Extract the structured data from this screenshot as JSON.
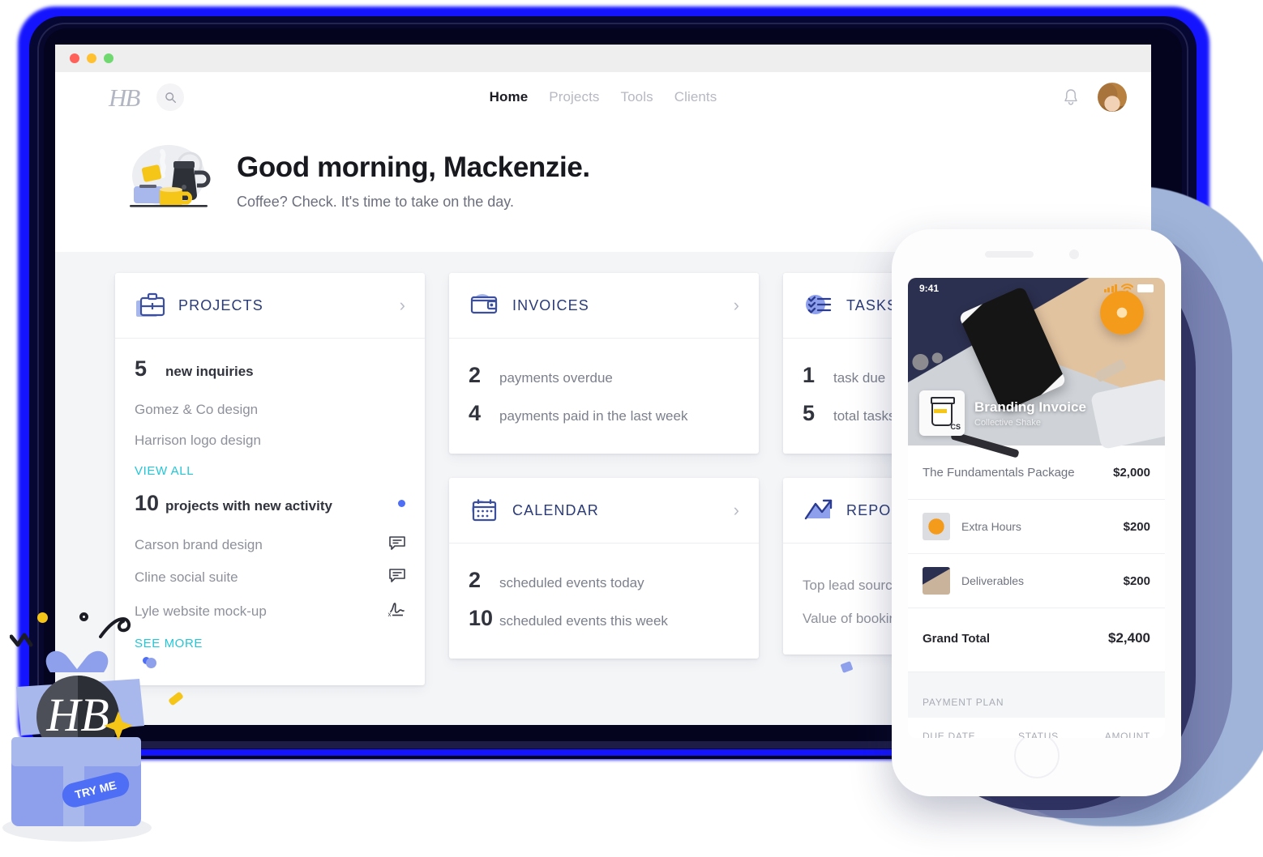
{
  "browser": {
    "traffic_lights": [
      "close",
      "minimize",
      "maximize"
    ]
  },
  "nav": {
    "logo": "HB",
    "search_icon": "search-icon",
    "links": [
      {
        "label": "Home",
        "active": true
      },
      {
        "label": "Projects",
        "active": false
      },
      {
        "label": "Tools",
        "active": false
      },
      {
        "label": "Clients",
        "active": false
      }
    ],
    "bell_icon": "bell-icon",
    "avatar": "user-avatar"
  },
  "greeting": {
    "title": "Good morning, Mackenzie.",
    "subtitle": "Coffee? Check. It's time to take on the day."
  },
  "cards": {
    "projects": {
      "title": "PROJECTS",
      "icon": "briefcase-icon",
      "stat1_num": "5",
      "stat1_label": "new inquiries",
      "items1": [
        "Gomez & Co design",
        "Harrison logo design"
      ],
      "link1": "VIEW ALL",
      "stat2_num": "10",
      "stat2_label": "projects with new activity",
      "items2": [
        {
          "name": "Carson brand design",
          "icon": "comment-icon"
        },
        {
          "name": "Cline social suite",
          "icon": "comment-icon"
        },
        {
          "name": "Lyle website mock-up",
          "icon": "signature-icon"
        }
      ],
      "link2": "SEE MORE"
    },
    "invoices": {
      "title": "INVOICES",
      "icon": "wallet-icon",
      "rows": [
        {
          "num": "2",
          "label": "payments overdue"
        },
        {
          "num": "4",
          "label": "payments paid in the last week"
        }
      ]
    },
    "calendar": {
      "title": "CALENDAR",
      "icon": "calendar-icon",
      "rows": [
        {
          "num": "2",
          "label": "scheduled events today"
        },
        {
          "num": "10",
          "label": "scheduled events this week"
        }
      ]
    },
    "tasks": {
      "title": "TASKS",
      "icon": "tasks-icon",
      "rows": [
        {
          "num": "1",
          "label": "task due"
        },
        {
          "num": "5",
          "label": "total tasks"
        }
      ]
    },
    "reports": {
      "title": "REPORTS",
      "icon": "chart-up-icon",
      "rows": [
        {
          "label": "Top lead source"
        },
        {
          "label": "Value of bookings"
        }
      ]
    }
  },
  "phone": {
    "status_time": "9:41",
    "signal_icon": "signal-bars-icon",
    "wifi_icon": "wifi-icon",
    "battery_icon": "battery-icon",
    "hero_title": "Branding Invoice",
    "hero_subtitle": "Collective Shake",
    "hero_logo_text": "CS",
    "line_items": [
      {
        "name": "The Fundamentals Package",
        "amount": "$2,000",
        "thumb": "none"
      },
      {
        "name": "Extra Hours",
        "amount": "$200",
        "thumb": "orange"
      },
      {
        "name": "Deliverables",
        "amount": "$200",
        "thumb": "keys"
      }
    ],
    "grand_total_label": "Grand Total",
    "grand_total_amount": "$2,400",
    "payment_plan_label": "PAYMENT PLAN",
    "plan_columns": [
      "DUE DATE",
      "STATUS",
      "AMOUNT"
    ]
  },
  "gift": {
    "logo_text": "HB",
    "ribbon_text": "TRY ME"
  },
  "colors": {
    "accent_blue": "#1414ff",
    "card_title": "#2b3b77",
    "link_teal": "#24c6d6",
    "dot_blue": "#4d6ef5",
    "periwinkle": "#8ea0ec"
  }
}
